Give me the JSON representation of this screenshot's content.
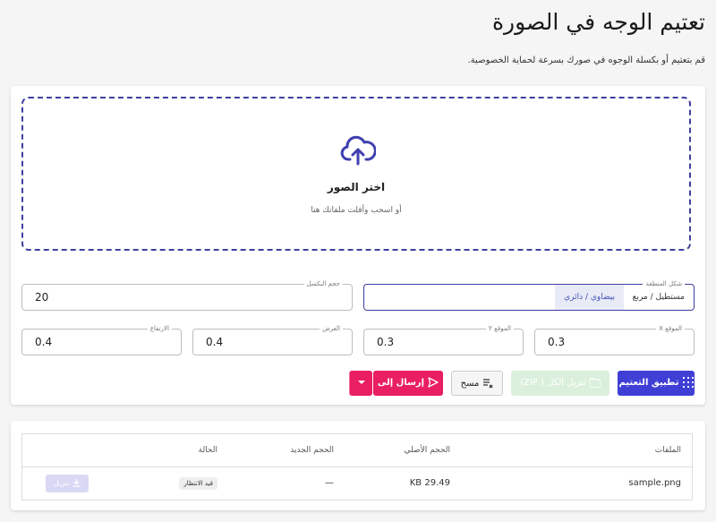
{
  "page": {
    "title": "تعتيم الوجه في الصورة",
    "subtitle": "قم بتعتيم أو بكسلة الوجوه في صورك بسرعة لحماية الخصوصية."
  },
  "dropzone": {
    "icon": "cloud-upload-icon",
    "title": "اختر الصور",
    "hint": "أو اسحب وأفلت ملفاتك هنا"
  },
  "options": {
    "shape": {
      "label": "شكل المنطقة",
      "options": [
        "مستطيل / مربع",
        "بيضاوي / دائري"
      ],
      "selected": "بيضاوي / دائري"
    },
    "pixel_size": {
      "label": "حجم البكسل",
      "value": "20"
    },
    "pos_x": {
      "label": "الموقع X",
      "value": "0.3"
    },
    "pos_y": {
      "label": "الموقع Y",
      "value": "0.3"
    },
    "width": {
      "label": "العرض",
      "value": "0.4"
    },
    "height": {
      "label": "الارتفاع",
      "value": "0.4"
    }
  },
  "actions": {
    "apply": "تطبيق التعتيم",
    "download_all": "تنزيل الكل (.ZIP)",
    "clear": "مسح",
    "send_to": "إرسال إلى"
  },
  "table": {
    "headers": {
      "file": "الملفات",
      "original_size": "الحجم الأصلي",
      "new_size": "الحجم الجديد",
      "status": "الحالة"
    },
    "rows": [
      {
        "file": "sample.png",
        "original_size": "29.49 KB",
        "new_size": "—",
        "status": "قيد الانتظار",
        "download": "تنزيل"
      }
    ]
  },
  "colors": {
    "primary": "#3f3fd6",
    "accent": "#e91e63",
    "success_light": "#dbf0dc",
    "border_dashed": "#3f3f9f"
  }
}
